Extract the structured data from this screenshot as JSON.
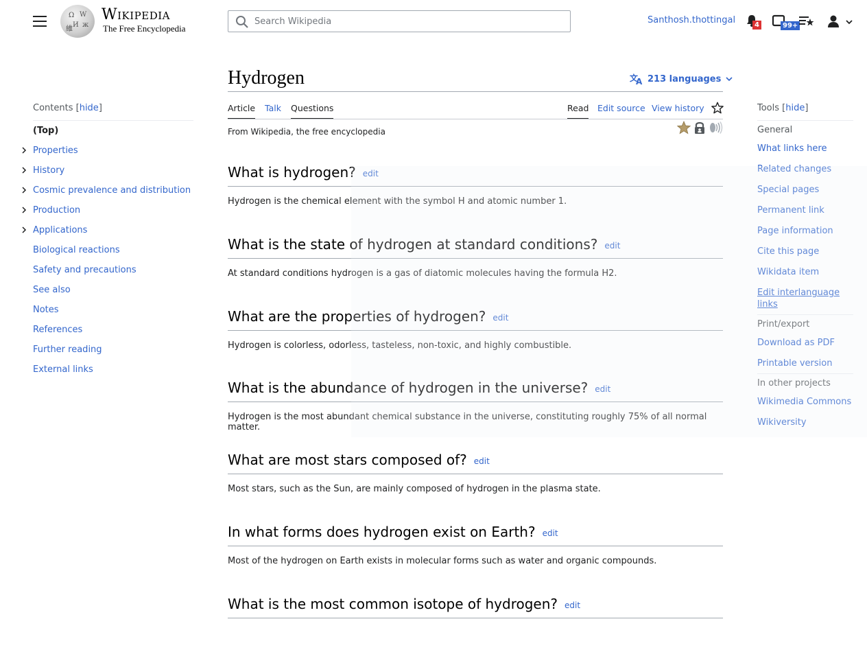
{
  "header": {
    "logo": {
      "wordmark": "Wikipedia",
      "tagline": "The Free Encyclopedia"
    },
    "search": {
      "placeholder": "Search Wikipedia",
      "value": ""
    },
    "username": "Santhosh.thottingal",
    "notifications_count": "4",
    "notices_count": "99+",
    "icons": [
      "menu-icon",
      "search-icon",
      "bell-icon",
      "tray-icon",
      "watchlist-icon",
      "user-icon",
      "chevron-down-icon"
    ]
  },
  "page": {
    "title": "Hydrogen",
    "languages_label": "213 languages",
    "tabs_left": [
      {
        "label": "Article",
        "state": "selected"
      },
      {
        "label": "Talk",
        "state": "link"
      },
      {
        "label": "Questions",
        "state": "selected"
      }
    ],
    "tabs_right": [
      {
        "label": "Read",
        "state": "selected"
      },
      {
        "label": "Edit source",
        "state": "link"
      },
      {
        "label": "View history",
        "state": "link"
      }
    ],
    "tagline": "From Wikipedia, the free encyclopedia",
    "indicators": [
      "featured-star-icon",
      "lock-icon",
      "audio-icon"
    ]
  },
  "toc": {
    "title": "Contents",
    "toggle": "hide",
    "items": [
      {
        "label": "(Top)",
        "expandable": false,
        "current": true
      },
      {
        "label": "Properties",
        "expandable": true
      },
      {
        "label": "History",
        "expandable": true
      },
      {
        "label": "Cosmic prevalence and distribution",
        "expandable": true
      },
      {
        "label": "Production",
        "expandable": true
      },
      {
        "label": "Applications",
        "expandable": true
      },
      {
        "label": "Biological reactions",
        "expandable": false
      },
      {
        "label": "Safety and precautions",
        "expandable": false
      },
      {
        "label": "See also",
        "expandable": false
      },
      {
        "label": "Notes",
        "expandable": false
      },
      {
        "label": "References",
        "expandable": false
      },
      {
        "label": "Further reading",
        "expandable": false
      },
      {
        "label": "External links",
        "expandable": false
      }
    ]
  },
  "tools": {
    "title": "Tools",
    "toggle": "hide",
    "sections": [
      {
        "heading": "General",
        "items": [
          "What links here",
          "Related changes",
          "Special pages",
          "Permanent link",
          "Page information",
          "Cite this page",
          "Wikidata item",
          "Edit interlanguage links"
        ]
      },
      {
        "heading": "Print/export",
        "items": [
          "Download as PDF",
          "Printable version"
        ]
      },
      {
        "heading": "In other projects",
        "items": [
          "Wikimedia Commons",
          "Wikiversity"
        ]
      }
    ]
  },
  "sections": [
    {
      "heading": "What is hydrogen?",
      "edit": "edit",
      "text": "Hydrogen is the chemical element with the symbol H and atomic number 1."
    },
    {
      "heading": "What is the state of hydrogen at standard conditions?",
      "edit": "edit",
      "text": "At standard conditions hydrogen is a gas of diatomic molecules having the formula H2."
    },
    {
      "heading": "What are the properties of hydrogen?",
      "edit": "edit",
      "text": "Hydrogen is colorless, odorless, tasteless, non-toxic, and highly combustible."
    },
    {
      "heading": "What is the abundance of hydrogen in the universe?",
      "edit": "edit",
      "text": "Hydrogen is the most abundant chemical substance in the universe, constituting roughly 75% of all normal matter."
    },
    {
      "heading": "What are most stars composed of?",
      "edit": "edit",
      "text": "Most stars, such as the Sun, are mainly composed of hydrogen in the plasma state."
    },
    {
      "heading": "In what forms does hydrogen exist on Earth?",
      "edit": "edit",
      "text": "Most of the hydrogen on Earth exists in molecular forms such as water and organic compounds."
    },
    {
      "heading": "What is the most common isotope of hydrogen?",
      "edit": "edit",
      "text": ""
    }
  ],
  "colors": {
    "link": "#3366cc",
    "text": "#202122",
    "badge_red": "#dd3333",
    "badge_blue": "#3366cc"
  }
}
